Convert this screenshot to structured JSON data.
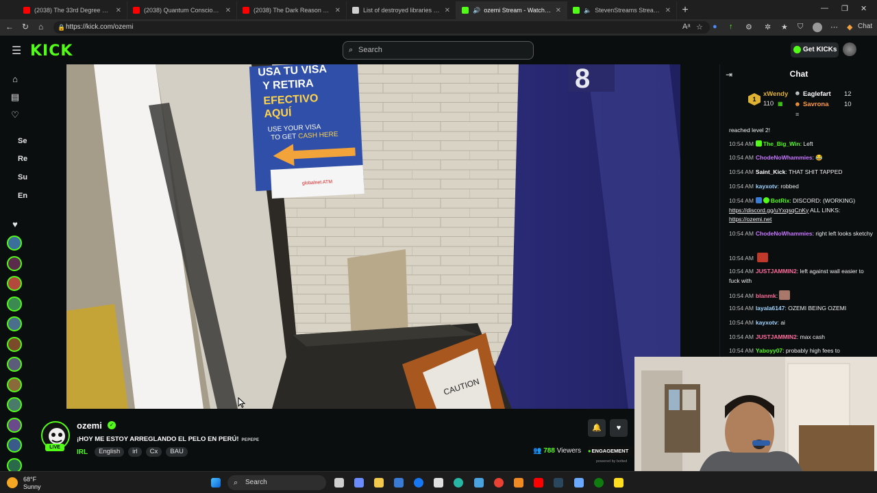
{
  "browser": {
    "tabs": [
      {
        "title": "(2038) The 33rd Degree System E",
        "favicon_color": "#ff0000"
      },
      {
        "title": "(2038) Quantum Consciousness Th",
        "favicon_color": "#ff0000"
      },
      {
        "title": "(2038) The Dark Reason They Des",
        "favicon_color": "#ff0000"
      },
      {
        "title": "List of destroyed libraries - Wikip",
        "favicon_color": "#cfcfcf"
      },
      {
        "title": "ozemi Stream - Watch Live on",
        "favicon_color": "#53fc18",
        "active": true,
        "audio": true
      },
      {
        "title": "StevenStreams Stream - Watc",
        "favicon_color": "#53fc18",
        "audio": true
      }
    ],
    "url": "https://kick.com/ozemi",
    "copilot_label": "Chat"
  },
  "header": {
    "logo": "KICK",
    "search_placeholder": "Search",
    "get_kicks_label": "Get KICKs"
  },
  "sidebar": {
    "section_labels": [
      "Se",
      "Re",
      "Su",
      "En"
    ],
    "channel_colors": [
      "#3c6e9b",
      "#5a2b4a",
      "#b3483c",
      "#3a8a52",
      "#4b6e8c",
      "#7a4a2a",
      "#5c5c7a",
      "#8a6a3a",
      "#4a7a6a",
      "#6a4a8a",
      "#3a5a8a",
      "#2a6a4a"
    ]
  },
  "stream": {
    "streamer": "ozemi",
    "live_label": "LIVE",
    "title": "¡HOY ME ESTOY ARREGLANDO EL PELO EN PERÚ!",
    "title_emote": "PEPEPE",
    "category": "IRL",
    "tags": [
      "English",
      "irl",
      "Cx",
      "BAU"
    ],
    "viewer_count": "788",
    "viewers_label": "Viewers",
    "engagement_label": "ENGAGEMENT",
    "powered_by": "powered by botted"
  },
  "video": {
    "sign_line1": "USA TU VISA",
    "sign_line2": "Y RETIRA",
    "sign_line3": "EFECTIVO",
    "sign_line4": "AQUÍ",
    "sign_line5": "USE YOUR VISA",
    "sign_line6a": "TO GET",
    "sign_line6b": "CASH HERE",
    "sign_brand": "globalnet ATM",
    "caution_text": "CAUTION",
    "door_number": "8"
  },
  "chat": {
    "title": "Chat",
    "leaderboard": [
      {
        "rank": "1",
        "name": "xWendy",
        "count": "110",
        "color": "#e0b234"
      },
      {
        "name": "Eaglefart",
        "count": "12",
        "color": "#f0f0f0"
      },
      {
        "name": "Savrona",
        "count": "10",
        "color": "#ff9a3c"
      }
    ],
    "messages": [
      {
        "time": "",
        "user": "",
        "color": "#53fc18",
        "text": "reached level 2!"
      },
      {
        "time": "10:54 AM",
        "user": "The_Big_Win",
        "color": "#53fc18",
        "text": "Left"
      },
      {
        "time": "10:54 AM",
        "user": "ChodeNoWhammies",
        "color": "#c776ff",
        "text": "😂"
      },
      {
        "time": "10:54 AM",
        "user": "Saint_Kick",
        "color": "#ffffff",
        "text": "THAT SHIT TAPPED"
      },
      {
        "time": "10:54 AM",
        "user": "kayxotv",
        "color": "#9fd3ff",
        "text": "robbed"
      },
      {
        "time": "10:54 AM",
        "user": "BotRix",
        "color": "#53fc18",
        "text": "DISCORD: (WORKING)",
        "link1": "https://discord.gg/uYxqsqCnKy",
        "mid": "ALL LINKS:",
        "link2": "https://ozemi.net"
      },
      {
        "time": "10:54 AM",
        "user": "ChodeNoWhammies",
        "color": "#c776ff",
        "text": "right left looks sketchy"
      },
      {
        "time": "10:54 AM",
        "user": "",
        "color": "#ff3b3b",
        "text": ""
      },
      {
        "time": "10:54 AM",
        "user": "JUSTJAMMIN2",
        "color": "#ff6b9a",
        "text": "left against wall easier to fuck with"
      },
      {
        "time": "10:54 AM",
        "user": "blanmk",
        "color": "#ff6b9a",
        "text": ""
      },
      {
        "time": "10:54 AM",
        "user": "layala6147",
        "color": "#9fd3ff",
        "text": "OZEMI BEING OZEMI"
      },
      {
        "time": "10:54 AM",
        "user": "kayxotv",
        "color": "#9fd3ff",
        "text": "ai"
      },
      {
        "time": "10:54 AM",
        "user": "JUSTJAMMIN2",
        "color": "#ff6b9a",
        "text": "max cash"
      },
      {
        "time": "10:54 AM",
        "user": "Yaboyy07",
        "color": "#53fc18",
        "text": "probably high fees to"
      }
    ]
  },
  "taskbar": {
    "temperature": "68°F",
    "condition": "Sunny",
    "search_label": "Search"
  }
}
